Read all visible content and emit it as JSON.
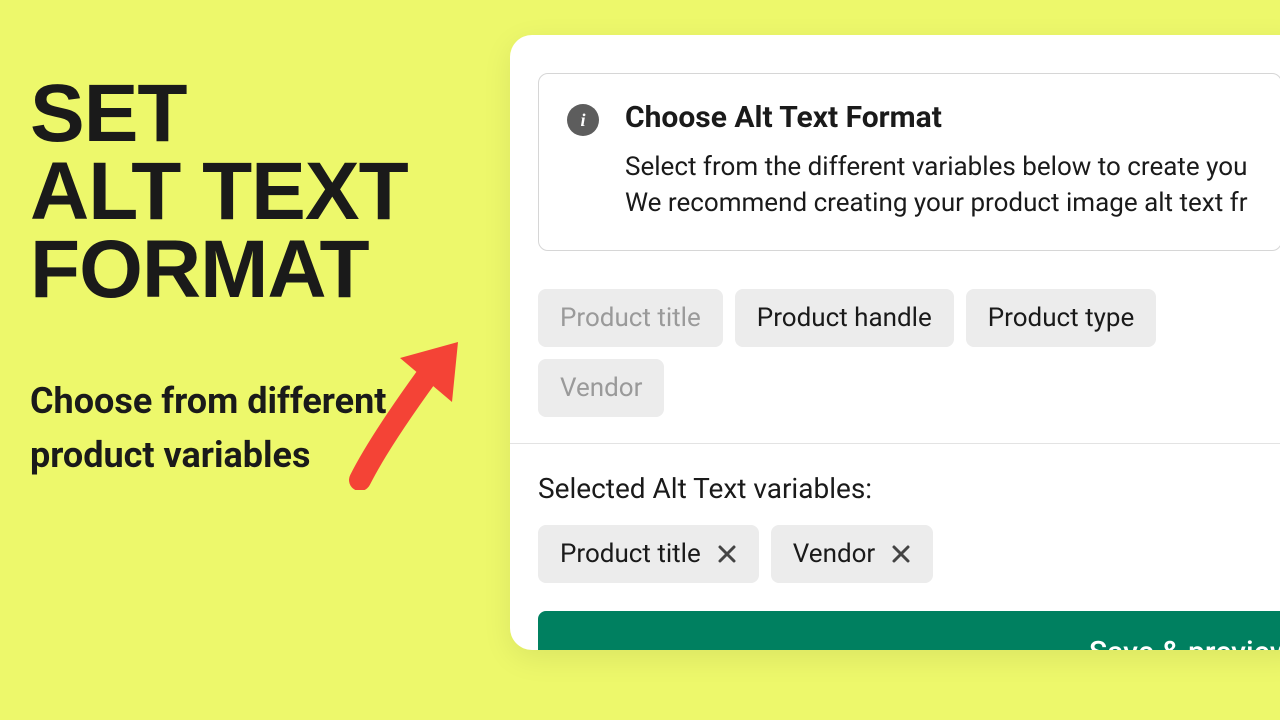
{
  "hero": {
    "headline": "SET\nALT TEXT\nFORMAT",
    "subhead": "Choose from different product variables"
  },
  "panel": {
    "info": {
      "title": "Choose Alt Text Format",
      "desc": "Select from the different variables below to create you\nWe recommend creating your product image alt text fr"
    },
    "options": [
      {
        "label": "Product title",
        "faded": true
      },
      {
        "label": "Product handle",
        "faded": false
      },
      {
        "label": "Product type",
        "faded": false
      },
      {
        "label": "Vendor",
        "faded": true
      }
    ],
    "selectedLabel": "Selected Alt Text variables:",
    "selected": [
      {
        "label": "Product title"
      },
      {
        "label": "Vendor"
      }
    ],
    "saveLabel": "Save & preview"
  }
}
